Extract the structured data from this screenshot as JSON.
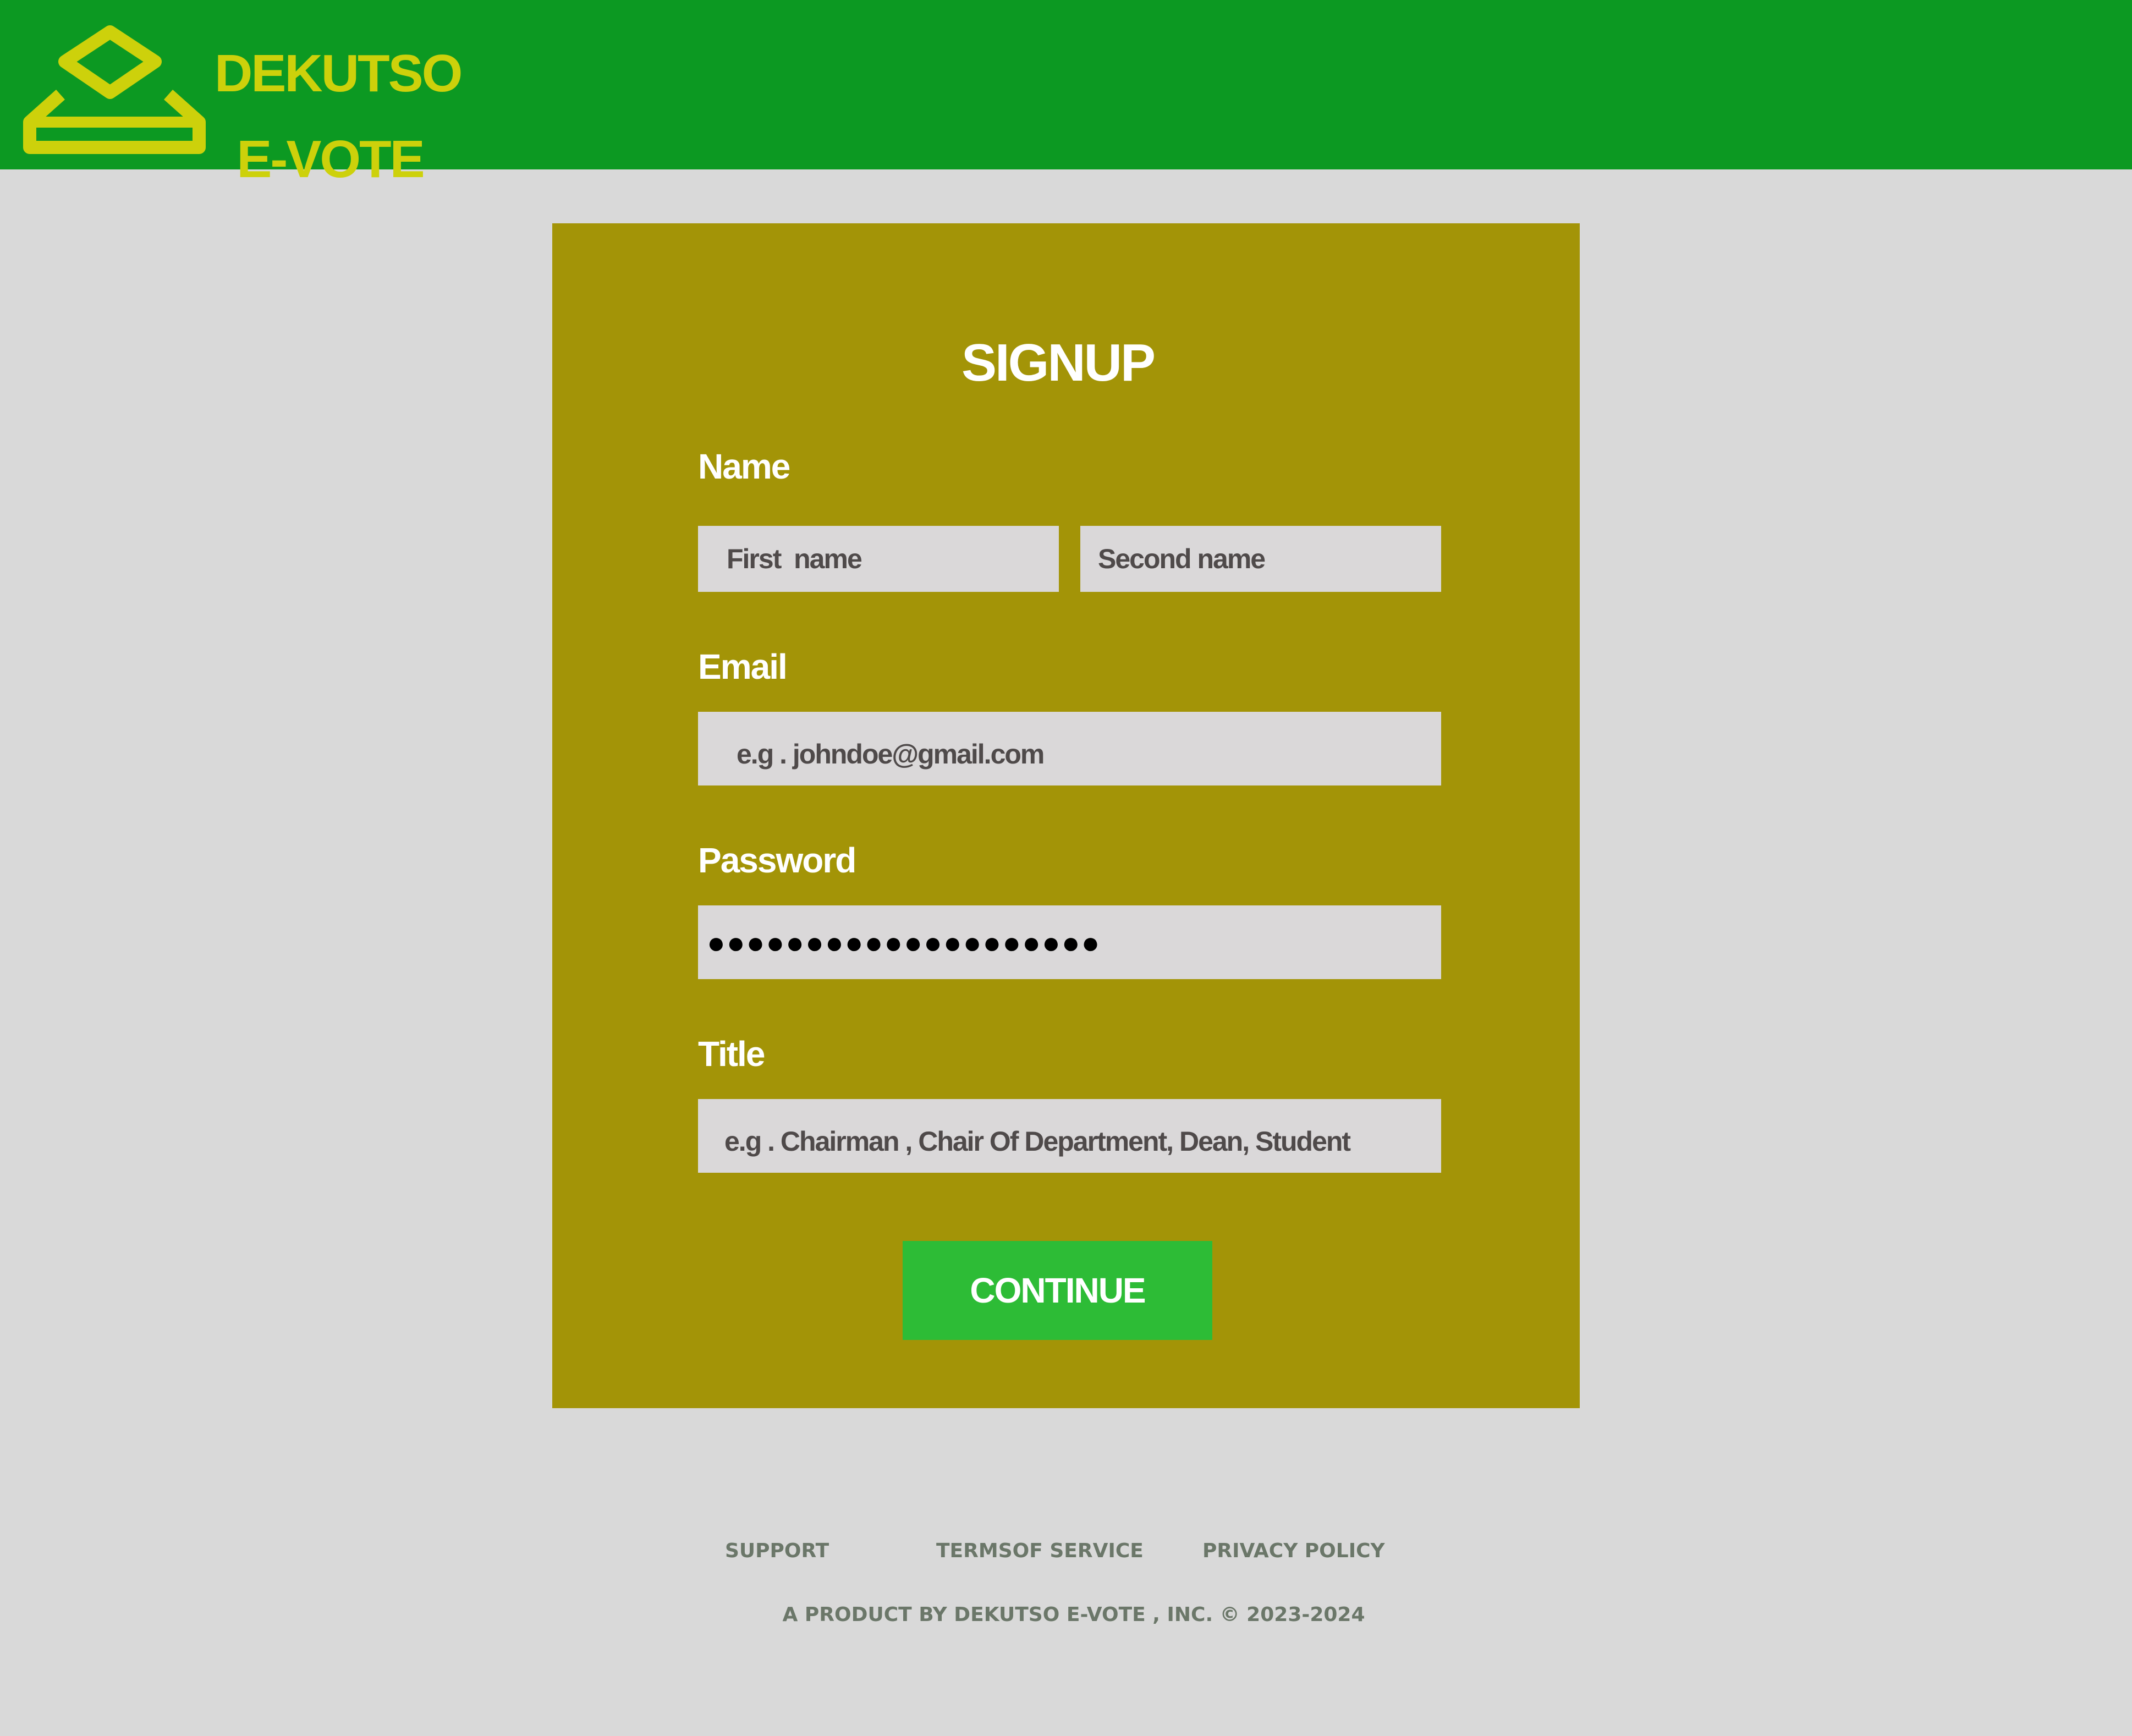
{
  "header": {
    "brand_line1": "DEKUTSO",
    "brand_line2": "E-VOTE",
    "logo_icon": "ballot-box-icon",
    "background_color": "#0c9922",
    "brand_color": "#cdd10b"
  },
  "form": {
    "title": "SIGNUP",
    "name_label": "Name",
    "first_name_placeholder": "First  name",
    "second_name_placeholder": "Second name",
    "email_label": "Email",
    "email_placeholder": "e.g . johndoe@gmail.com",
    "password_label": "Password",
    "password_value": "●●●●●●●●●●●●●●●●●●●●",
    "title_label": "Title",
    "title_placeholder": "e.g . Chairman , Chair Of Department, Dean, Student",
    "continue_label": "CONTINUE",
    "card_color": "#a39407",
    "button_color": "#2dbc36"
  },
  "footer": {
    "support": "Support",
    "terms": "Termsof Service",
    "privacy": "Privacy policy",
    "copyright": "A product by DEKUTSO E-Vote , Inc. © 2023-2024"
  }
}
